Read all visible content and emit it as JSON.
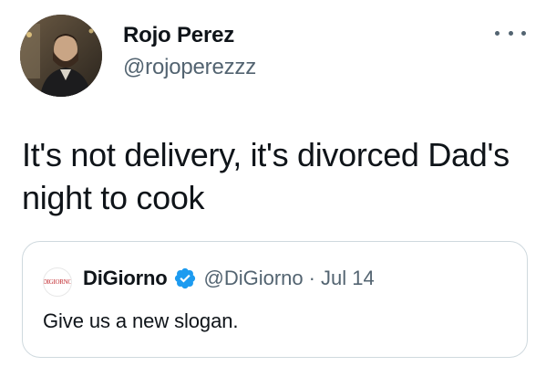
{
  "tweet": {
    "author_name": "Rojo Perez",
    "author_handle": "@rojoperezzz",
    "more_icon": "more-horizontal-icon",
    "text": "It's not delivery, it's divorced Dad's night to cook"
  },
  "quote": {
    "avatar_text": "DIGIORNO",
    "author_name": "DiGiorno",
    "verified_icon": "verified-badge-icon",
    "author_handle": "@DiGiorno",
    "separator": "·",
    "date": "Jul 14",
    "text": "Give us a new slogan."
  },
  "colors": {
    "text_primary": "#0f1419",
    "text_secondary": "#536471",
    "verified_blue": "#1d9bf0",
    "border": "#cfd9de",
    "brand_red": "#c0282d"
  }
}
